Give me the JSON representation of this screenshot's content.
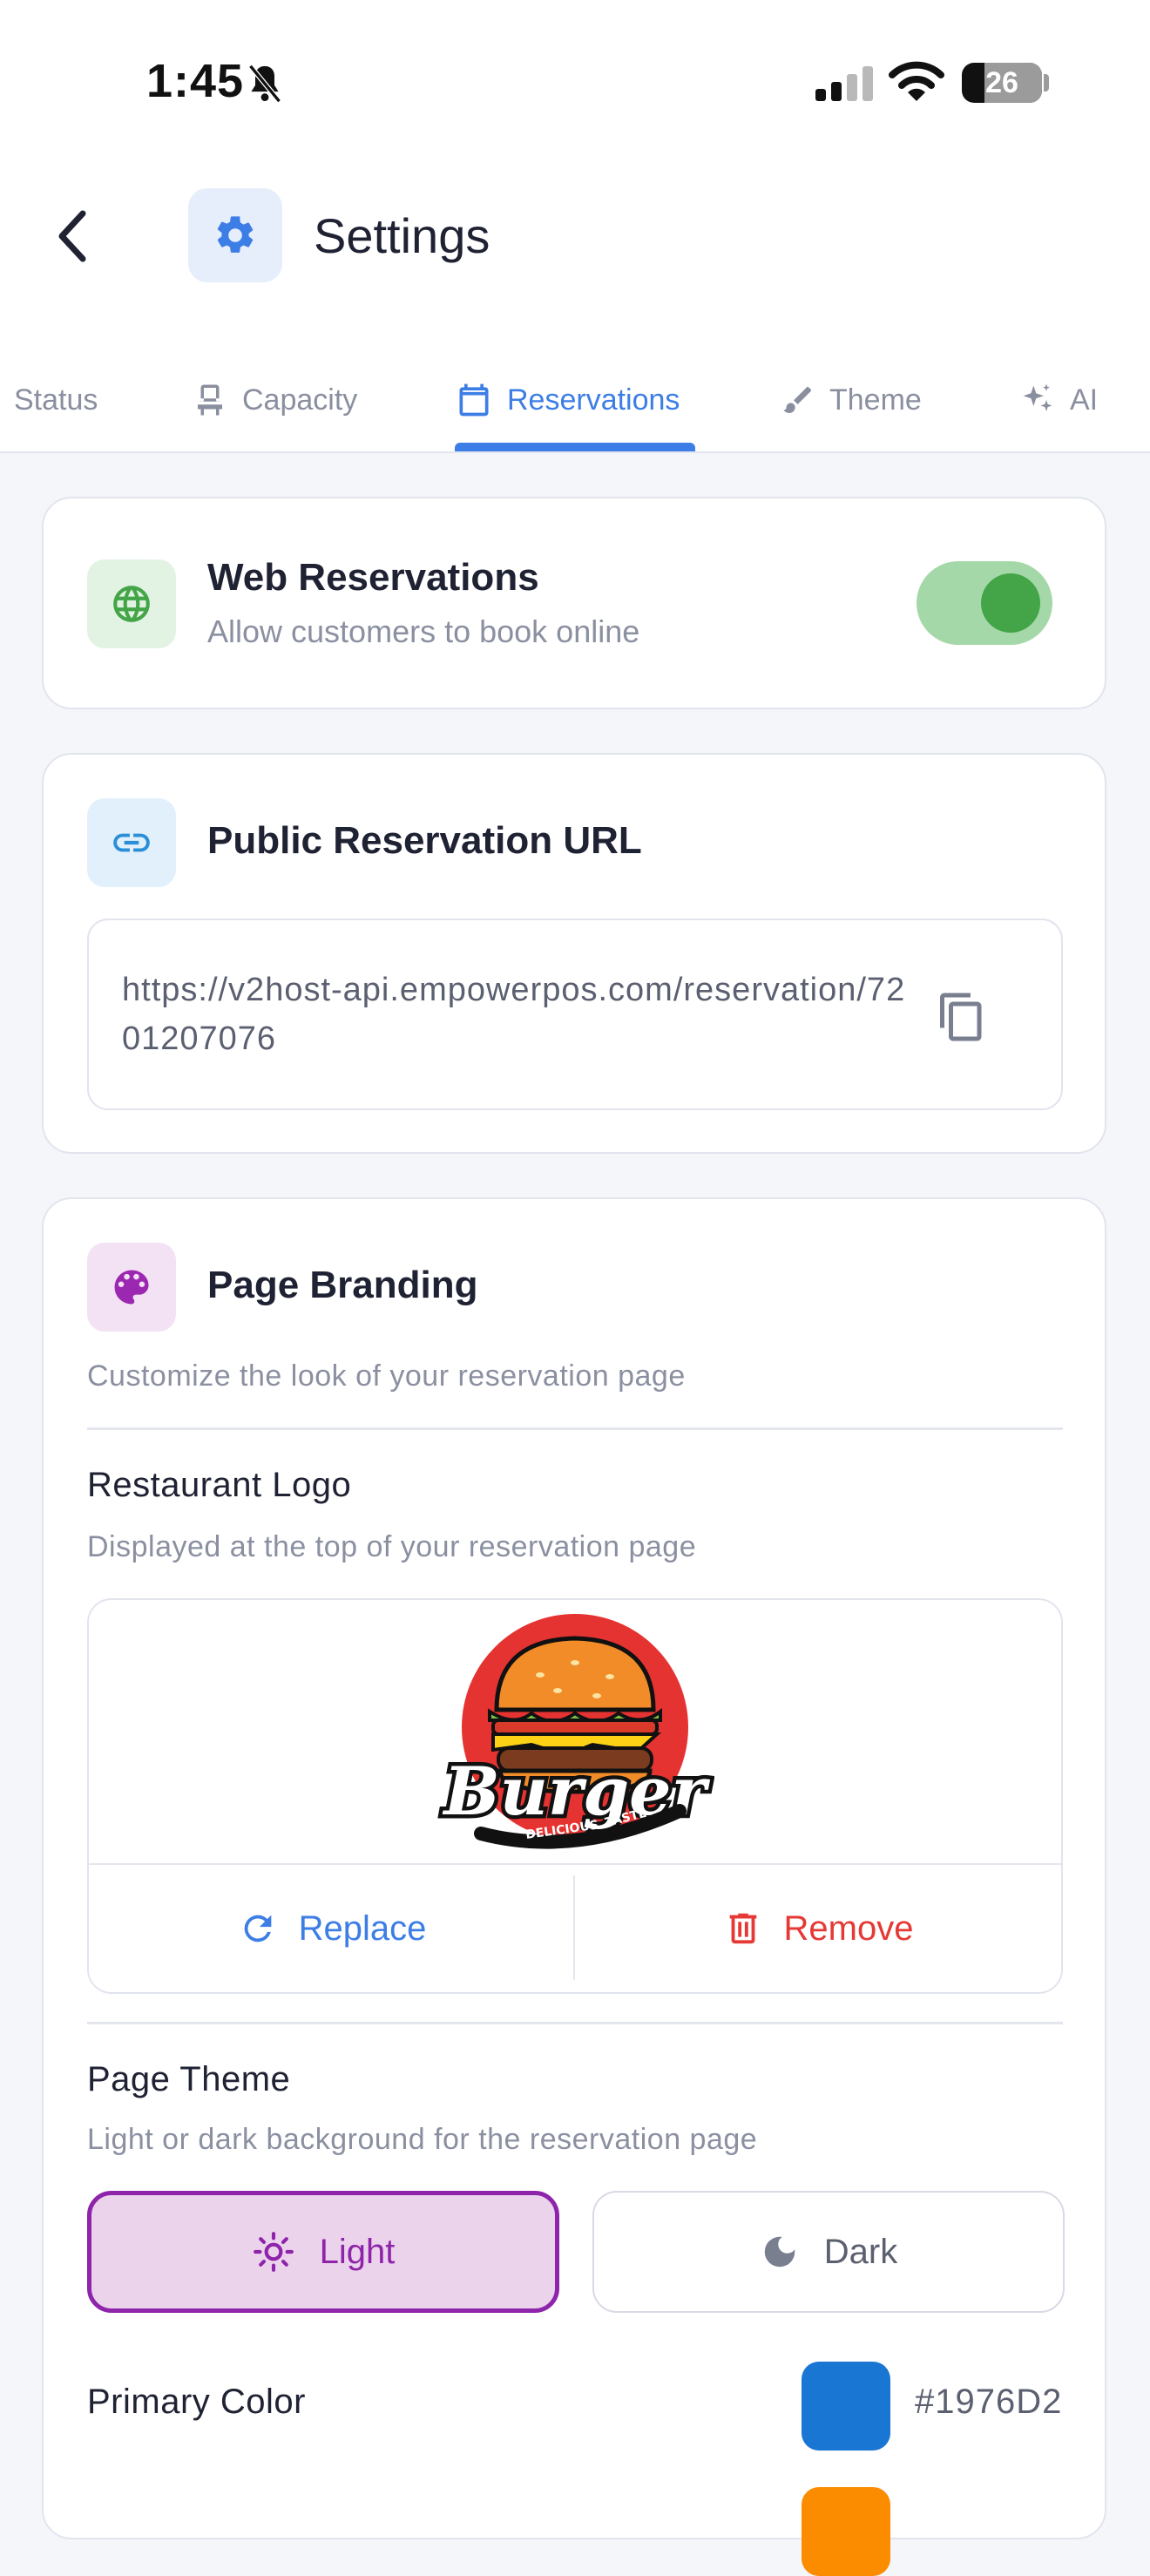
{
  "status_bar": {
    "time": "1:45",
    "battery": "26"
  },
  "header": {
    "title": "Settings",
    "back_icon": "chevron-left-icon",
    "title_icon": "gear-icon"
  },
  "tabs": [
    {
      "label": "Status",
      "icon": "",
      "active": false
    },
    {
      "label": "Capacity",
      "icon": "chair-icon",
      "active": false
    },
    {
      "label": "Reservations",
      "icon": "calendar-icon",
      "active": true
    },
    {
      "label": "Theme",
      "icon": "brush-icon",
      "active": false
    },
    {
      "label": "AI",
      "icon": "sparkles-icon",
      "active": false
    }
  ],
  "web_reservations": {
    "title": "Web Reservations",
    "subtitle": "Allow customers to book online",
    "enabled": true
  },
  "public_url": {
    "title": "Public Reservation URL",
    "url": "https://v2host-api.empowerpos.com/reservation/7201207076"
  },
  "branding": {
    "title": "Page Branding",
    "description": "Customize the look of your reservation page",
    "logo": {
      "label": "Restaurant Logo",
      "description": "Displayed at the top of your reservation page",
      "logo_text": "Burger",
      "logo_tagline_left": "DELICIOUS",
      "logo_tagline_right": "TASTE",
      "replace_label": "Replace",
      "remove_label": "Remove"
    },
    "page_theme": {
      "label": "Page Theme",
      "description": "Light or dark background for the reservation page",
      "options": [
        "Light",
        "Dark"
      ],
      "selected": "Light"
    },
    "primary_color": {
      "label": "Primary Color",
      "value": "#1976D2"
    },
    "secondary_color": {
      "value": "#FB8C00"
    }
  },
  "colors": {
    "accent": "#3D7EE6",
    "toggle_on": "#43A547",
    "danger": "#E53935",
    "theme_selected": "#8E24AA"
  }
}
